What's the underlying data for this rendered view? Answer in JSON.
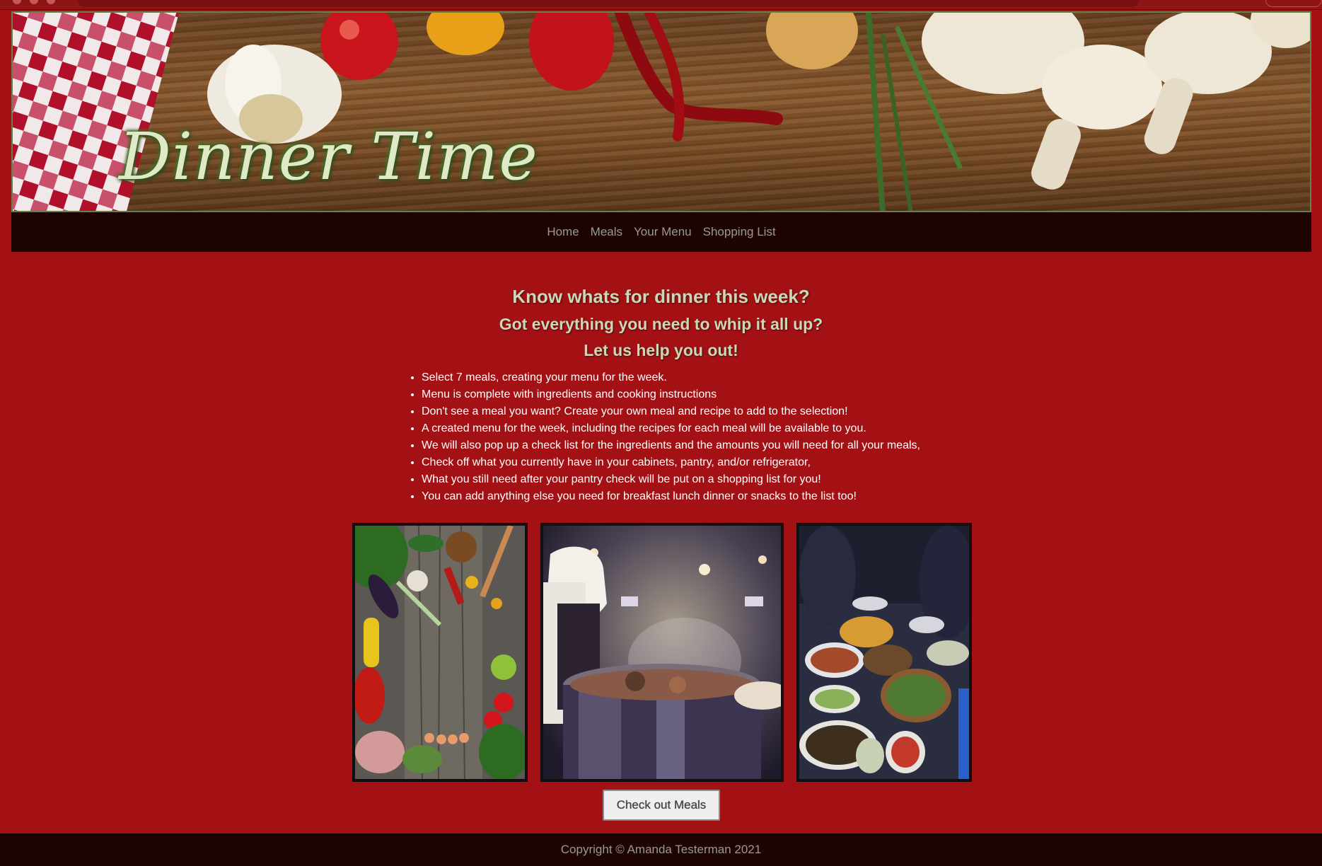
{
  "banner": {
    "title": "Dinner Time"
  },
  "nav": {
    "items": [
      "Home",
      "Meals",
      "Your Menu",
      "Shopping List"
    ]
  },
  "hero": {
    "line1": "Know whats for dinner this week?",
    "line2": "Got everything you need to whip it all up?",
    "line3": "Let us help you out!"
  },
  "features": [
    "Select 7 meals, creating your menu for the week.",
    "Menu is complete with ingredients and cooking instructions",
    "Don't see a meal you want? Create your own meal and recipe to add to the selection!",
    "A created menu for the week, including the recipes for each meal will be available to you.",
    "We will also pop up a check list for the ingredients and the amounts you will need for all your meals,",
    "Check off what you currently have in your cabinets, pantry, and/or refrigerator,",
    "What you still need after your pantry check will be put on a shopping list for you!",
    "You can add anything else you need for breakfast lunch dinner or snacks to the list too!"
  ],
  "cta": {
    "label": "Check out Meals"
  },
  "footer": {
    "copyright": "Copyright © Amanda Testerman 2021"
  },
  "colors": {
    "page_bg": "#a31114",
    "nav_bg": "#1e0304",
    "heading": "#c9d8b6",
    "banner_title": "#dfe9c6"
  }
}
